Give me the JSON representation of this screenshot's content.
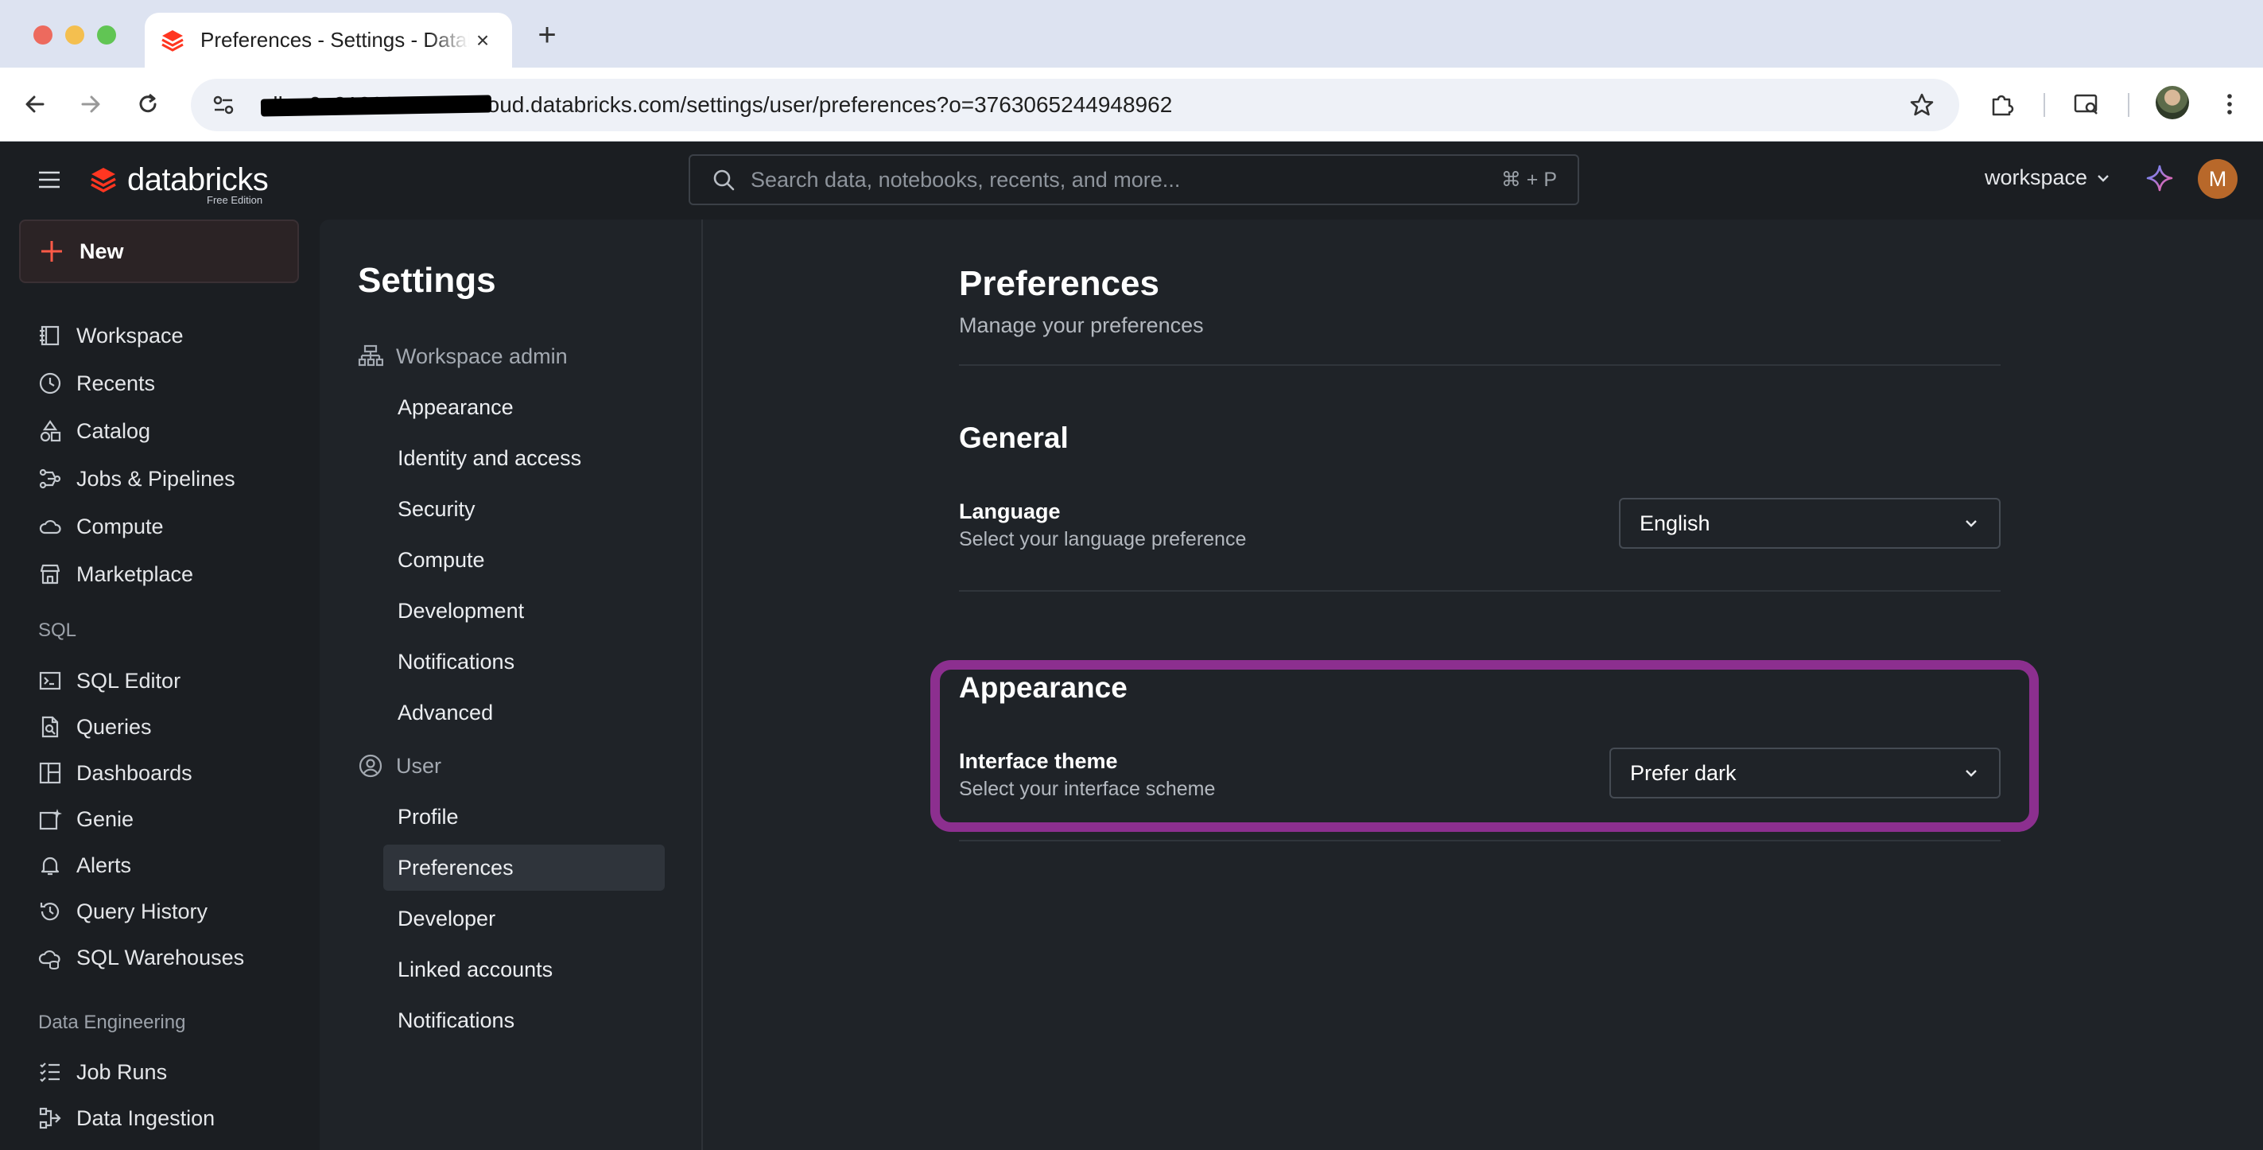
{
  "browser": {
    "tab_title": "Preferences - Settings - Databricks",
    "new_tab": "+",
    "url_host": "dbc-0a318888-387b.cloud.databricks.com",
    "url_path": "/settings/user/preferences?o=3763065244948962"
  },
  "app": {
    "logo_text": "databricks",
    "logo_sub": "Free Edition",
    "search_placeholder": "Search data, notebooks, recents, and more...",
    "search_shortcut": "⌘ + P",
    "workspace_label": "workspace",
    "avatar_initial": "M"
  },
  "sidebar": {
    "new_label": "New",
    "items": [
      {
        "label": "Workspace",
        "icon": "workspace-icon"
      },
      {
        "label": "Recents",
        "icon": "clock-icon"
      },
      {
        "label": "Catalog",
        "icon": "catalog-icon"
      },
      {
        "label": "Jobs & Pipelines",
        "icon": "pipelines-icon"
      },
      {
        "label": "Compute",
        "icon": "cloud-icon"
      },
      {
        "label": "Marketplace",
        "icon": "store-icon"
      }
    ],
    "sql_section": "SQL",
    "sql_items": [
      {
        "label": "SQL Editor",
        "icon": "terminal-icon"
      },
      {
        "label": "Queries",
        "icon": "query-file-icon"
      },
      {
        "label": "Dashboards",
        "icon": "dashboard-icon"
      },
      {
        "label": "Genie",
        "icon": "genie-icon"
      },
      {
        "label": "Alerts",
        "icon": "bell-icon"
      },
      {
        "label": "Query History",
        "icon": "history-icon"
      },
      {
        "label": "SQL Warehouses",
        "icon": "warehouse-icon"
      }
    ],
    "de_section": "Data Engineering",
    "de_items": [
      {
        "label": "Job Runs",
        "icon": "list-check-icon"
      },
      {
        "label": "Data Ingestion",
        "icon": "ingestion-icon"
      }
    ]
  },
  "settings": {
    "title": "Settings",
    "workspace_admin": "Workspace admin",
    "admin_items": [
      "Appearance",
      "Identity and access",
      "Security",
      "Compute",
      "Development",
      "Notifications",
      "Advanced"
    ],
    "user": "User",
    "user_items": [
      "Profile",
      "Preferences",
      "Developer",
      "Linked accounts",
      "Notifications"
    ],
    "active_item": "Preferences"
  },
  "preferences": {
    "title": "Preferences",
    "subtitle": "Manage your preferences",
    "general": {
      "title": "General",
      "language_label": "Language",
      "language_desc": "Select your language preference",
      "language_value": "English"
    },
    "appearance": {
      "title": "Appearance",
      "theme_label": "Interface theme",
      "theme_desc": "Select your interface scheme",
      "theme_value": "Prefer dark"
    }
  },
  "colors": {
    "brand": "#ff3621",
    "highlight": "#8c2f8f",
    "background": "#1b1e22",
    "panel": "#1f2328"
  }
}
